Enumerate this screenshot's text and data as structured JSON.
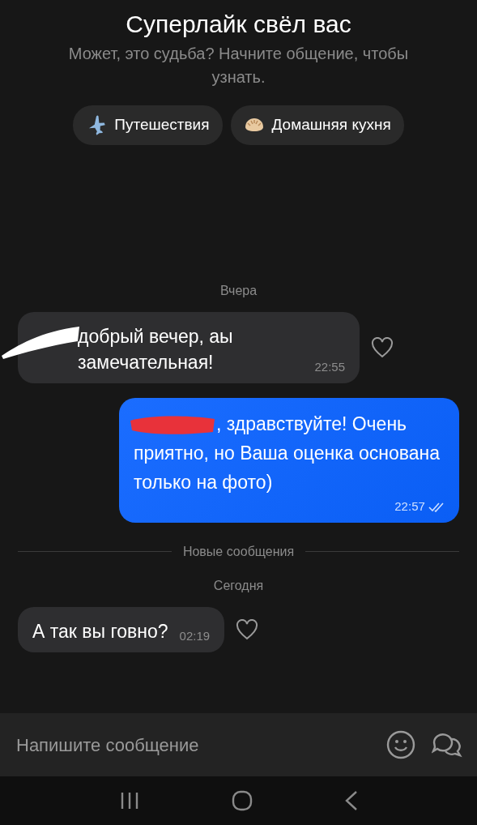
{
  "header": {
    "title": "Суперлайк свёл вас",
    "subtitle": "Может, это судьба? Начните общение, чтобы узнать."
  },
  "interests": [
    {
      "label": "Путешествия",
      "kind": "plane"
    },
    {
      "label": "Домашняя кухня",
      "kind": "dumpling"
    }
  ],
  "messages": [
    {
      "kind": "date",
      "text": "Вчера"
    },
    {
      "kind": "incoming",
      "text": "добрый вечер, аы замечательная!",
      "time": "22:55",
      "redacted": true,
      "liked": false
    },
    {
      "kind": "outgoing",
      "text": ", здравствуйте! Очень приятно, но Ваша оценка основана только на фото)",
      "time": "22:57",
      "redacted": true,
      "read": true
    },
    {
      "kind": "divider",
      "text": "Новые сообщения"
    },
    {
      "kind": "date",
      "text": "Сегодня"
    },
    {
      "kind": "incoming",
      "text": "А так вы говно?",
      "time": "02:19",
      "redacted": false,
      "liked": false
    }
  ],
  "composer": {
    "placeholder": "Напишите сообщение"
  }
}
